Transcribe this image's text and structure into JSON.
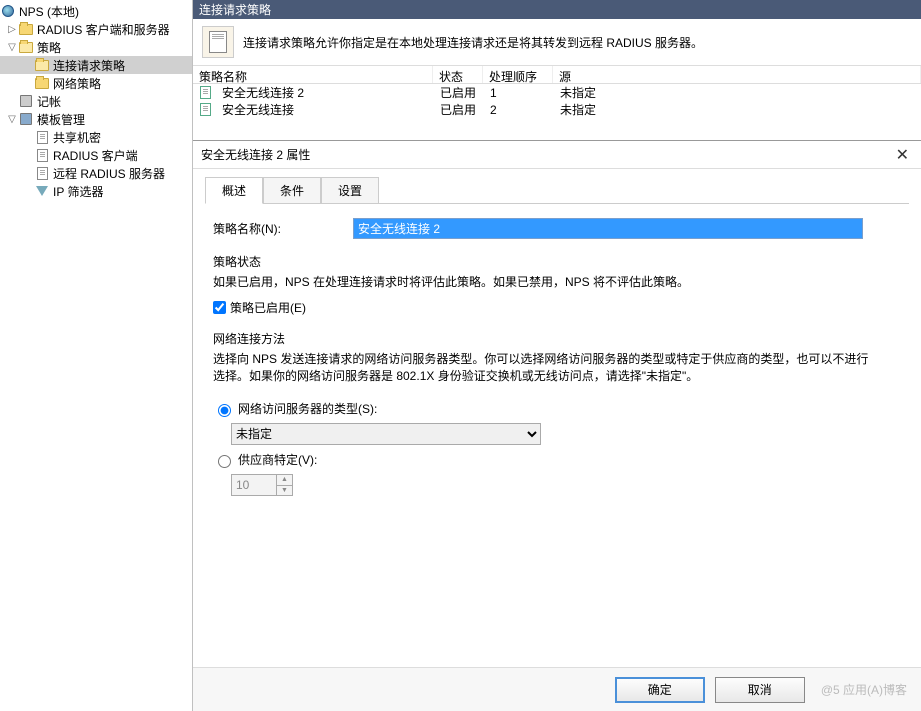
{
  "sidebar": {
    "root": "NPS (本地)",
    "items": [
      "RADIUS 客户端和服务器",
      "策略",
      "连接请求策略",
      "网络策略",
      "记帐",
      "模板管理",
      "共享机密",
      "RADIUS 客户端",
      "远程 RADIUS 服务器",
      "IP 筛选器"
    ]
  },
  "header": {
    "title": "连接请求策略",
    "info": "连接请求策略允许你指定是在本地处理连接请求还是将其转发到远程 RADIUS 服务器。"
  },
  "table": {
    "cols": [
      "策略名称",
      "状态",
      "处理顺序",
      "源"
    ],
    "rows": [
      {
        "name": "安全无线连接 2",
        "status": "已启用",
        "order": "1",
        "source": "未指定"
      },
      {
        "name": "安全无线连接",
        "status": "已启用",
        "order": "2",
        "source": "未指定"
      }
    ]
  },
  "dialog": {
    "title": "安全无线连接 2 属性",
    "tabs": [
      "概述",
      "条件",
      "设置"
    ],
    "name_label": "策略名称(N):",
    "name_value": "安全无线连接 2",
    "state_title": "策略状态",
    "state_desc": "如果已启用，NPS 在处理连接请求时将评估此策略。如果已禁用，NPS 将不评估此策略。",
    "enable_chk": "策略已启用(E)",
    "conn_title": "网络连接方法",
    "conn_desc": "选择向 NPS 发送连接请求的网络访问服务器类型。你可以选择网络访问服务器的类型或特定于供应商的类型，也可以不进行选择。如果你的网络访问服务器是 802.1X 身份验证交换机或无线访问点，请选择\"未指定\"。",
    "radio1": "网络访问服务器的类型(S):",
    "select_val": "未指定",
    "radio2": "供应商特定(V):",
    "spin_val": "10",
    "ok": "确定",
    "cancel": "取消",
    "watermark": "@5 应用(A)博客"
  }
}
